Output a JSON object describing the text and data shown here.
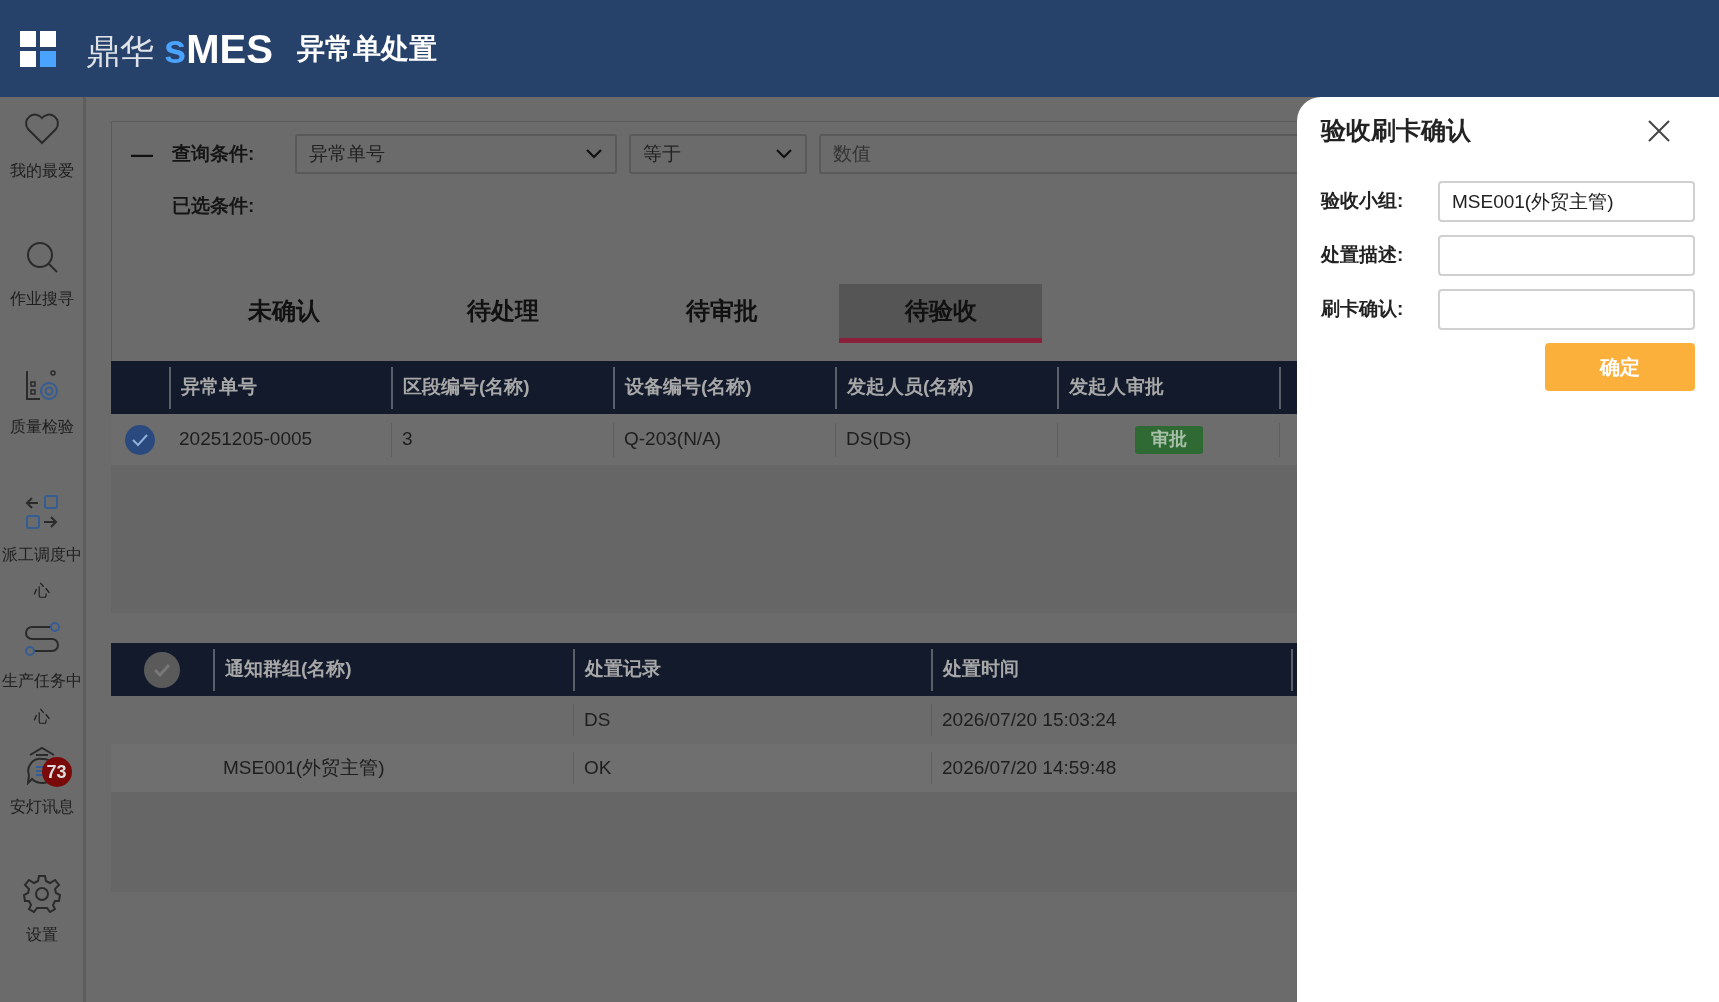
{
  "header": {
    "logo_cn": "鼎华",
    "logo_s": "s",
    "logo_mes": "MES",
    "title": "异常单处置"
  },
  "sidebar": {
    "items": [
      {
        "kind": "heart",
        "label": "我的最爱"
      },
      {
        "kind": "search",
        "label": "作业搜寻"
      },
      {
        "kind": "quality",
        "label": "质量检验"
      },
      {
        "kind": "dispatch",
        "label": "派工调度中心"
      },
      {
        "kind": "route",
        "label": "生产任务中心"
      },
      {
        "kind": "andon",
        "label": "安灯讯息",
        "badge": "73"
      },
      {
        "kind": "gear",
        "label": "设置"
      }
    ]
  },
  "query": {
    "collapse": "—",
    "label": "查询条件:",
    "field": "异常单号",
    "operator": "等于",
    "placeholder": "数值",
    "selected_label": "已选条件:"
  },
  "tabs": [
    {
      "label": "未确认",
      "selected": false
    },
    {
      "label": "待处理",
      "selected": false
    },
    {
      "label": "待审批",
      "selected": false
    },
    {
      "label": "待验收",
      "selected": true
    }
  ],
  "table": {
    "columns": [
      "异常单号",
      "区段编号(名称)",
      "设备编号(名称)",
      "发起人员(名称)",
      "发起人审批"
    ],
    "rows": [
      {
        "checked": true,
        "cells": [
          "20251205-0005",
          "3",
          "Q-203(N/A)",
          "DS(DS)"
        ],
        "action": "审批"
      }
    ]
  },
  "records": {
    "all_checked": false,
    "columns": [
      "通知群组(名称)",
      "处置记录",
      "处置时间"
    ],
    "rows": [
      [
        "",
        "DS",
        "2026/07/20 15:03:24"
      ],
      [
        "MSE001(外贸主管)",
        "OK",
        "2026/07/20 14:59:48"
      ]
    ]
  },
  "dialog": {
    "title": "验收刷卡确认",
    "fields": [
      {
        "label": "验收小组:",
        "value": "MSE001(外贸主管)"
      },
      {
        "label": "处置描述:"
      },
      {
        "label": "刷卡确认:"
      }
    ],
    "confirm": "确定"
  }
}
